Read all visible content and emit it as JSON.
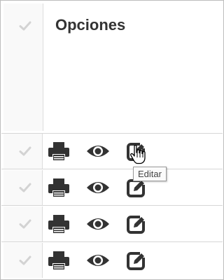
{
  "table": {
    "header_title": "Opciones",
    "rows": [
      {
        "print_icon": "print-icon",
        "view_icon": "eye-icon",
        "edit_icon": "edit-icon"
      },
      {
        "print_icon": "print-icon",
        "view_icon": "eye-icon",
        "edit_icon": "edit-icon"
      },
      {
        "print_icon": "print-icon",
        "view_icon": "eye-icon",
        "edit_icon": "edit-icon"
      },
      {
        "print_icon": "print-icon",
        "view_icon": "eye-icon",
        "edit_icon": "edit-icon"
      }
    ]
  },
  "tooltip": {
    "text": "Editar"
  },
  "colors": {
    "icon": "#333333",
    "check": "#d3d3d3",
    "border": "#bdbdbd",
    "check_column_bg": "#f9f9f9"
  }
}
